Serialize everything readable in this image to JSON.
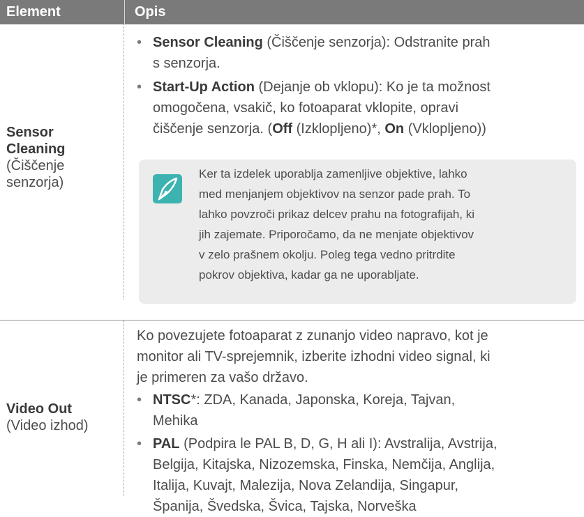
{
  "header": {
    "col1": "Element",
    "col2": "Opis"
  },
  "rows": [
    {
      "label_bold_lines": [
        "Sensor",
        "Cleaning"
      ],
      "label_sub_lines": [
        "(Čiščenje",
        "senzorja)"
      ],
      "items": [
        {
          "bold": "Sensor Cleaning",
          "lines": [
            "(Čiščenje senzorja): Odstranite prah",
            "s senzorja."
          ]
        },
        {
          "bold": "Start-Up Action",
          "lines": [
            "(Dejanje ob vklopu): Ko je ta možnost",
            "omogočena, vsakič, ko fotoaparat vklopite, opravi",
            "čiščenje senzorja. ("
          ],
          "tail": {
            "off_bold": "Off",
            "off_text": " (Izklopljeno)*, ",
            "on_bold": "On",
            "on_text": " (Vklopljeno))"
          }
        }
      ],
      "note": {
        "icon": "pen-nib-icon",
        "lines": [
          "Ker ta izdelek uporablja zamenljive objektive, lahko",
          "med menjanjem objektivov na senzor pade prah. To",
          "lahko povzroči prikaz delcev prahu na fotografijah, ki",
          "jih zajemate. Priporočamo, da ne menjate objektivov",
          "v zelo prašnem okolju. Poleg tega vedno pritrdite",
          "pokrov objektiva, kadar ga ne uporabljate."
        ]
      }
    },
    {
      "label_bold_lines": [
        "Video Out"
      ],
      "label_sub_lines": [
        "(Video izhod)"
      ],
      "intro_lines": [
        "Ko povezujete fotoaparat z zunanjo video napravo, kot je",
        "monitor ali TV-sprejemnik, izberite izhodni video signal, ki",
        "je primeren za vašo državo."
      ],
      "items": [
        {
          "bold": "NTSC",
          "lines": [
            "*: ZDA, Kanada, Japonska, Koreja, Tajvan,",
            "Mehika"
          ]
        },
        {
          "bold": "PAL",
          "lines": [
            " (Podpira le PAL B, D, G, H ali I): Avstralija, Avstrija,",
            "Belgija, Kitajska, Nizozemska, Finska, Nemčija, Anglija,",
            "Italija, Kuvajt, Malezija, Nova Zelandija, Singapur,",
            "Španija, Švedska, Švica, Tajska, Norveška"
          ]
        }
      ]
    }
  ],
  "colors": {
    "header_bg": "#7a7a7a",
    "note_bg": "#ececec",
    "icon_bg": "#3cb3b0",
    "text": "#4d4d4d"
  }
}
